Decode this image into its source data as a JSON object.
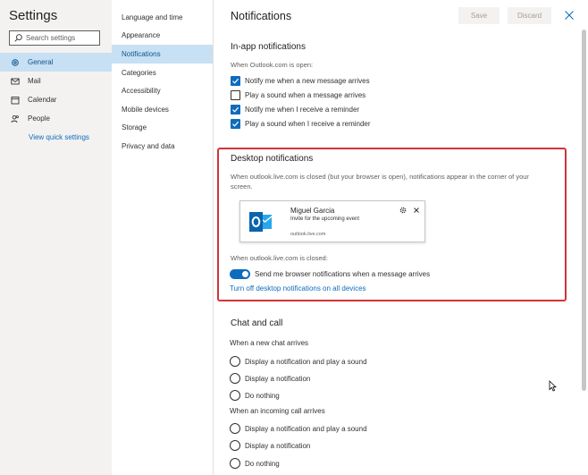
{
  "settings": {
    "title": "Settings",
    "search_placeholder": "Search settings",
    "nav": [
      {
        "label": "General",
        "icon": "gear-icon"
      },
      {
        "label": "Mail",
        "icon": "mail-icon"
      },
      {
        "label": "Calendar",
        "icon": "calendar-icon"
      },
      {
        "label": "People",
        "icon": "people-icon"
      }
    ],
    "quick_settings_link": "View quick settings"
  },
  "subnav": {
    "items": [
      "Language and time",
      "Appearance",
      "Notifications",
      "Categories",
      "Accessibility",
      "Mobile devices",
      "Storage",
      "Privacy and data"
    ],
    "active": "Notifications"
  },
  "page": {
    "title": "Notifications",
    "save_label": "Save",
    "discard_label": "Discard"
  },
  "inapp": {
    "title": "In-app notifications",
    "subtitle": "When Outlook.com is open:",
    "options": [
      {
        "label": "Notify me when a new message arrives",
        "checked": true
      },
      {
        "label": "Play a sound when a message arrives",
        "checked": false
      },
      {
        "label": "Notify me when I receive a reminder",
        "checked": true
      },
      {
        "label": "Play a sound when I receive a reminder",
        "checked": true
      }
    ]
  },
  "desktop": {
    "title": "Desktop notifications",
    "description_line1": "When outlook.live.com is closed (but your browser is open), notifications appear in the corner of your",
    "description_line2": "screen.",
    "preview": {
      "sender": "Miguel Garcia",
      "message": "Invite for the upcoming event",
      "domain": "outlook.live.com"
    },
    "closed_label": "When outlook.live.com is closed:",
    "toggle_label": "Send me browser notifications when a message arrives",
    "toggle_on": true,
    "turn_off_link": "Turn off desktop notifications on all devices"
  },
  "chat": {
    "title": "Chat and call",
    "new_chat_label": "When a new chat arrives",
    "chat_options": [
      "Display a notification and play a sound",
      "Display a notification",
      "Do nothing"
    ],
    "incoming_call_label": "When an incoming call arrives",
    "call_options": [
      "Display a notification and play a sound",
      "Display a notification",
      "Do nothing"
    ]
  },
  "colors": {
    "accent": "#0f6cbd",
    "highlight": "#c7e0f4",
    "frame": "#d13438"
  }
}
